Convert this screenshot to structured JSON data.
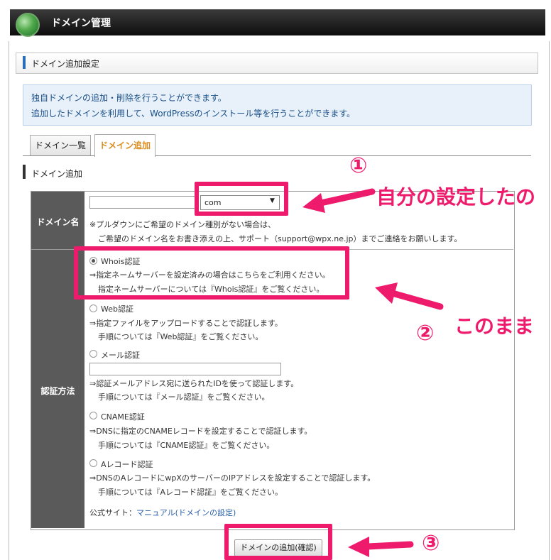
{
  "header": {
    "title": "ドメイン管理"
  },
  "section": {
    "title": "ドメイン追加設定"
  },
  "info": {
    "line1": "独自ドメインの追加・削除を行うことができます。",
    "line2": "追加したドメインを利用して、WordPressのインストール等を行うことができます。"
  },
  "tabs": [
    {
      "label": "ドメイン一覧"
    },
    {
      "label": "ドメイン追加"
    }
  ],
  "subsection": {
    "title": "ドメイン追加"
  },
  "form": {
    "domain_label": "ドメイン名",
    "domain_value": "",
    "tld_selected": "com",
    "tld_note1": "※プルダウンにご希望のドメイン種別がない場合は、",
    "tld_note2": "ご希望のドメイン名をお書き添えの上、サポート（support@wpx.ne.jp）までご連絡をお願いします。",
    "auth_label": "認証方法",
    "methods": [
      {
        "name": "Whois認証",
        "line1": "⇒指定ネームサーバーを設定済みの場合はこちらをご利用ください。",
        "line2": "指定ネームサーバーについては『Whois認証』をご覧ください。",
        "selected": true
      },
      {
        "name": "Web認証",
        "line1": "⇒指定ファイルをアップロードすることで認証します。",
        "line2": "手順については『Web認証』をご覧ください。",
        "selected": false
      },
      {
        "name": "メール認証",
        "line1": "⇒認証メールアドレス宛に送られたIDを使って認証します。",
        "line2": "手順については『メール認証』をご覧ください。",
        "selected": false
      },
      {
        "name": "CNAME認証",
        "line1": "⇒DNSに指定のCNAMEレコードを設定することで認証します。",
        "line2": "手順については『CNAME認証』をご覧ください。",
        "selected": false
      },
      {
        "name": "Aレコード認証",
        "line1": "⇒DNSのAレコードにwpXのサーバーのIPアドレスを設定することで認証します。",
        "line2": "手順については『Aレコード認証』をご覧ください。",
        "selected": false
      }
    ],
    "mail_value": "",
    "official_prefix": "公式サイト：",
    "official_link": "マニュアル(ドメインの設定)",
    "submit_label": "ドメインの追加(確認)"
  },
  "annotations": {
    "num1": "①",
    "text1": "自分の設定したの",
    "num2": "②",
    "text2": "このまま",
    "num3": "③",
    "color": "#ee1a6c"
  }
}
